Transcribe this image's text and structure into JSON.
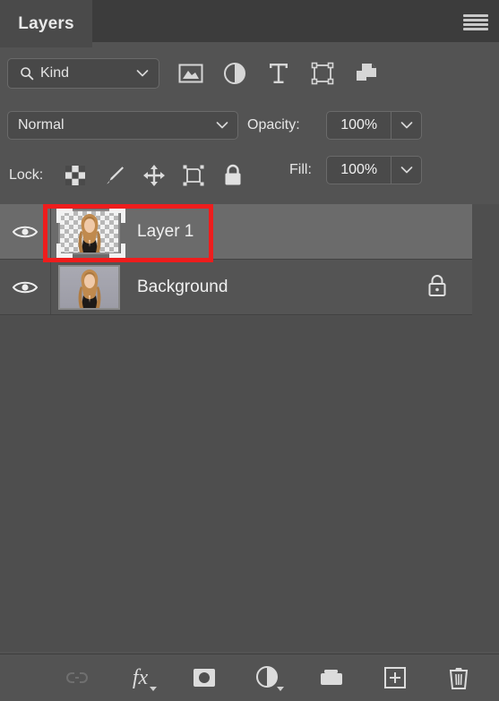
{
  "panel": {
    "title": "Layers",
    "menu_icon": "hamburger-menu-icon"
  },
  "filter_bar": {
    "kind_label": "Kind",
    "search_icon": "search-icon",
    "chevron_icon": "chevron-down-icon",
    "filter_icons": [
      {
        "name": "pixel-layer-filter-icon",
        "title": "Filter for pixel layers"
      },
      {
        "name": "adjustment-layer-filter-icon",
        "title": "Filter for adjustment layers"
      },
      {
        "name": "type-layer-filter-icon",
        "title": "Filter for type layers"
      },
      {
        "name": "shape-layer-filter-icon",
        "title": "Filter for shape layers"
      },
      {
        "name": "smart-object-filter-icon",
        "title": "Filter for smart objects"
      }
    ],
    "toggle": {
      "name": "filter-enable-toggle",
      "state": "off"
    }
  },
  "blend_bar": {
    "blend_mode": "Normal",
    "opacity_label": "Opacity:",
    "opacity_value": "100%"
  },
  "lock_bar": {
    "lock_label": "Lock:",
    "lock_icons": [
      {
        "name": "lock-transparent-pixels-icon"
      },
      {
        "name": "lock-image-pixels-icon"
      },
      {
        "name": "lock-position-icon"
      },
      {
        "name": "lock-artboard-nesting-icon"
      },
      {
        "name": "lock-all-icon"
      }
    ],
    "fill_label": "Fill:",
    "fill_value": "100%"
  },
  "layers": [
    {
      "name": "Layer 1",
      "selected": true,
      "visible": true,
      "thumbnail": "transparent-cutout-portrait",
      "locked": false
    },
    {
      "name": "Background",
      "selected": false,
      "visible": true,
      "thumbnail": "portrait-photo",
      "locked": true
    }
  ],
  "annotation": {
    "shape": "rectangle",
    "color": "#ee1d1d",
    "target": "Layer 1 thumbnail and name"
  },
  "bottom_toolbar": [
    {
      "name": "link-layers-button",
      "icon": "link-icon",
      "enabled": false
    },
    {
      "name": "layer-style-button",
      "icon": "fx-icon",
      "label": "fx",
      "enabled": true
    },
    {
      "name": "add-layer-mask-button",
      "icon": "mask-icon",
      "enabled": true
    },
    {
      "name": "new-adjustment-layer-button",
      "icon": "half-circle-icon",
      "enabled": true
    },
    {
      "name": "new-group-button",
      "icon": "folder-icon",
      "enabled": true
    },
    {
      "name": "new-layer-button",
      "icon": "plus-square-icon",
      "enabled": true
    },
    {
      "name": "delete-layer-button",
      "icon": "trash-icon",
      "enabled": true
    }
  ]
}
